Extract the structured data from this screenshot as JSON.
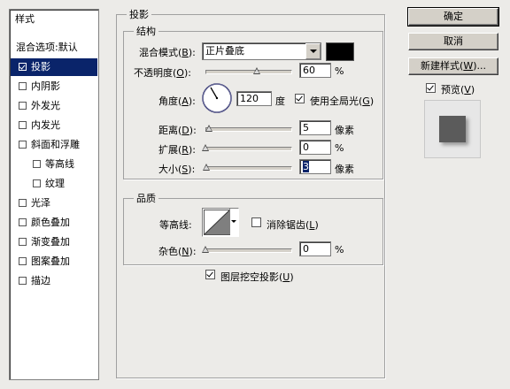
{
  "style_list": {
    "header": "样式",
    "items": [
      {
        "label": "混合选项:默认",
        "has_checkbox": false,
        "indent": 0,
        "selected": false
      },
      {
        "label": "投影",
        "has_checkbox": true,
        "checked": true,
        "indent": 0,
        "selected": true
      },
      {
        "label": "内阴影",
        "has_checkbox": true,
        "checked": false,
        "indent": 0,
        "selected": false
      },
      {
        "label": "外发光",
        "has_checkbox": true,
        "checked": false,
        "indent": 0,
        "selected": false
      },
      {
        "label": "内发光",
        "has_checkbox": true,
        "checked": false,
        "indent": 0,
        "selected": false
      },
      {
        "label": "斜面和浮雕",
        "has_checkbox": true,
        "checked": false,
        "indent": 0,
        "selected": false
      },
      {
        "label": "等高线",
        "has_checkbox": true,
        "checked": false,
        "indent": 1,
        "selected": false
      },
      {
        "label": "纹理",
        "has_checkbox": true,
        "checked": false,
        "indent": 1,
        "selected": false
      },
      {
        "label": "光泽",
        "has_checkbox": true,
        "checked": false,
        "indent": 0,
        "selected": false
      },
      {
        "label": "颜色叠加",
        "has_checkbox": true,
        "checked": false,
        "indent": 0,
        "selected": false
      },
      {
        "label": "渐变叠加",
        "has_checkbox": true,
        "checked": false,
        "indent": 0,
        "selected": false
      },
      {
        "label": "图案叠加",
        "has_checkbox": true,
        "checked": false,
        "indent": 0,
        "selected": false
      },
      {
        "label": "描边",
        "has_checkbox": true,
        "checked": false,
        "indent": 0,
        "selected": false
      }
    ]
  },
  "drop_shadow": {
    "title": "投影",
    "structure": {
      "title": "结构",
      "blend_mode_label": "混合模式(",
      "blend_mode_key": "B",
      "blend_mode_value": "正片叠底",
      "shadow_color": "#000000",
      "opacity_label": "不透明度(",
      "opacity_key": "O",
      "opacity_value": "60",
      "opacity_unit": "%",
      "opacity_fraction": 0.6,
      "angle_label": "角度(",
      "angle_key": "A",
      "angle_value": "120",
      "angle_unit": "度",
      "global_light_label": "使用全局光(",
      "global_light_key": "G",
      "global_light_checked": true,
      "distance_label": "距离(",
      "distance_key": "D",
      "distance_value": "5",
      "distance_unit": "像素",
      "spread_label": "扩展(",
      "spread_key": "R",
      "spread_value": "0",
      "spread_unit": "%",
      "size_label": "大小(",
      "size_key": "S",
      "size_value": "3",
      "size_unit": "像素"
    },
    "quality": {
      "title": "品质",
      "contour_label": "等高线:",
      "anti_alias_label": "消除锯齿(",
      "anti_alias_key": "L",
      "anti_alias_checked": false,
      "noise_label": "杂色(",
      "noise_key": "N",
      "noise_value": "0",
      "noise_unit": "%"
    },
    "knockout_label": "图层挖空投影(",
    "knockout_key": "U",
    "knockout_checked": true
  },
  "buttons": {
    "ok": "确定",
    "cancel": "取消",
    "new_style": "新建样式(",
    "new_style_key": "W",
    "new_style_tail": ")..."
  },
  "preview": {
    "label": "预览(",
    "key": "V",
    "checked": true
  },
  "close_paren": ")",
  "colon_suffix": "):"
}
